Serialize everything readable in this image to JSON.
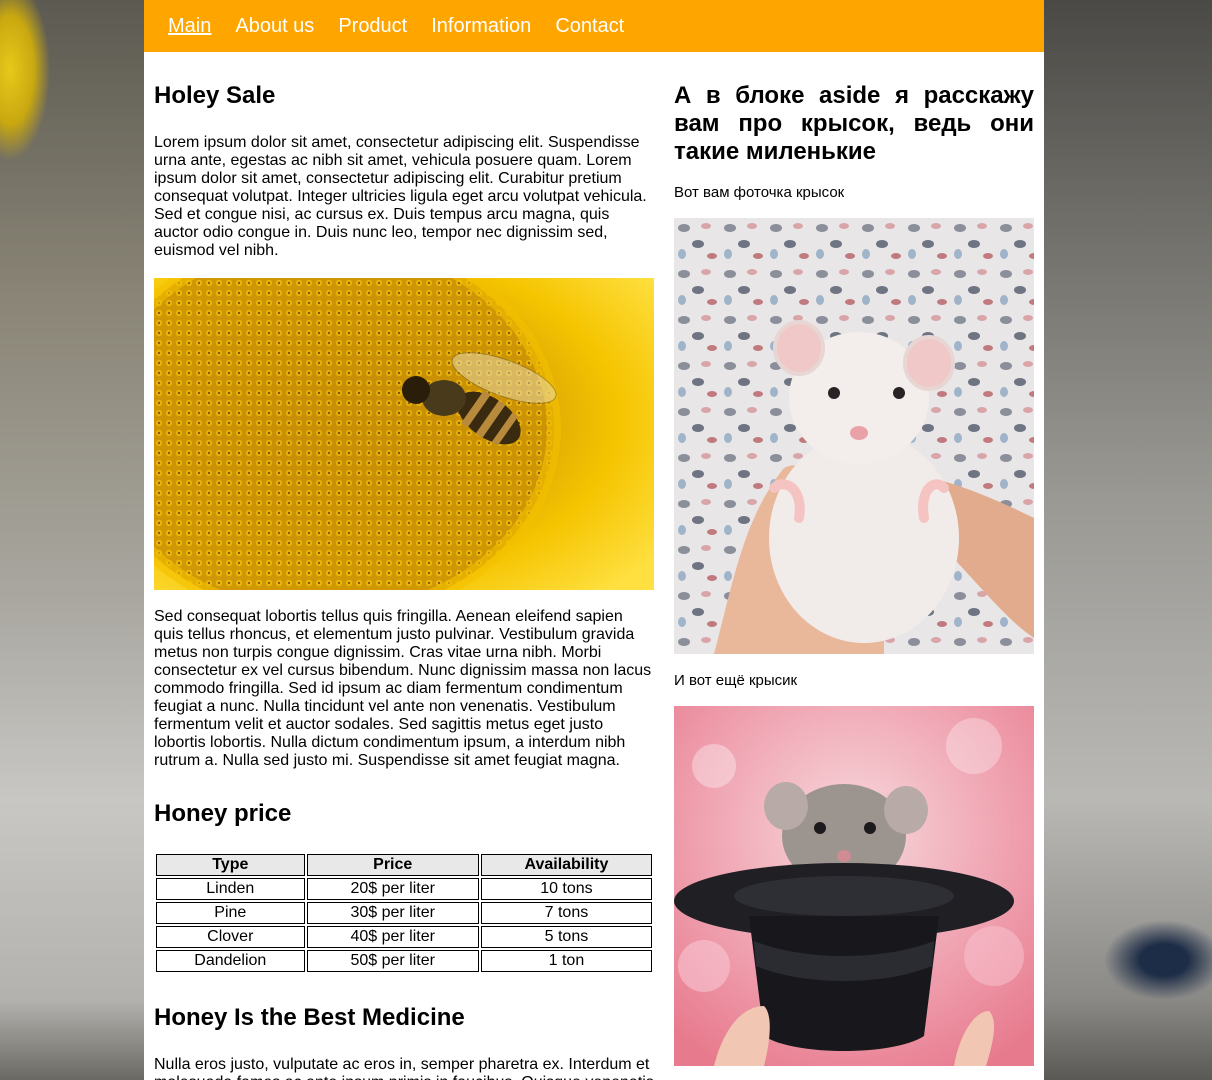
{
  "nav": {
    "items": [
      "Main",
      "About us",
      "Product",
      "Information",
      "Contact"
    ]
  },
  "main": {
    "heading1": "Holey Sale",
    "para1": "Lorem ipsum dolor sit amet, consectetur adipiscing elit. Suspendisse urna ante, egestas ac nibh sit amet, vehicula posuere quam. Lorem ipsum dolor sit amet, consectetur adipiscing elit. Curabitur pretium consequat volutpat. Integer ultricies ligula eget arcu volutpat vehicula. Sed et congue nisi, ac cursus ex. Duis tempus arcu magna, quis auctor odio congue in. Duis nunc leo, tempor nec dignissim sed, euismod vel nibh.",
    "para2": "Sed consequat lobortis tellus quis fringilla. Aenean eleifend sapien quis tellus rhoncus, et elementum justo pulvinar. Vestibulum gravida metus non turpis congue dignissim. Cras vitae urna nibh. Morbi consectetur ex vel cursus bibendum. Nunc dignissim massa non lacus commodo fringilla. Sed id ipsum ac diam fermentum condimentum feugiat a nunc. Nulla tincidunt vel ante non venenatis. Vestibulum fermentum velit et auctor sodales. Sed sagittis metus eget justo lobortis lobortis. Nulla dictum condimentum ipsum, a interdum nibh rutrum a. Nulla sed justo mi. Suspendisse sit amet feugiat magna.",
    "heading2": "Honey price",
    "table": {
      "headers": [
        "Type",
        "Price",
        "Availability"
      ],
      "rows": [
        [
          "Linden",
          "20$ per liter",
          "10 tons"
        ],
        [
          "Pine",
          "30$ per liter",
          "7 tons"
        ],
        [
          "Clover",
          "40$ per liter",
          "5 tons"
        ],
        [
          "Dandelion",
          "50$ per liter",
          "1 ton"
        ]
      ]
    },
    "heading3": "Honey Is the Best Medicine",
    "para3": "Nulla eros justo, vulputate ac eros in, semper pharetra ex. Interdum et malesuada fames ac ante ipsum primis in faucibus. Quisque venenatis pellentesque lacus, eget commodo velit. Vivamus porta lobortis elit,"
  },
  "aside": {
    "heading": "А в блоке aside я расскажу вам про крысок, ведь они такие миленькие",
    "caption1": "Вот вам фоточка крысок",
    "caption2": "И вот ещё крысик"
  },
  "colors": {
    "nav_bg": "#ffa500",
    "nav_text": "#ffffff"
  }
}
